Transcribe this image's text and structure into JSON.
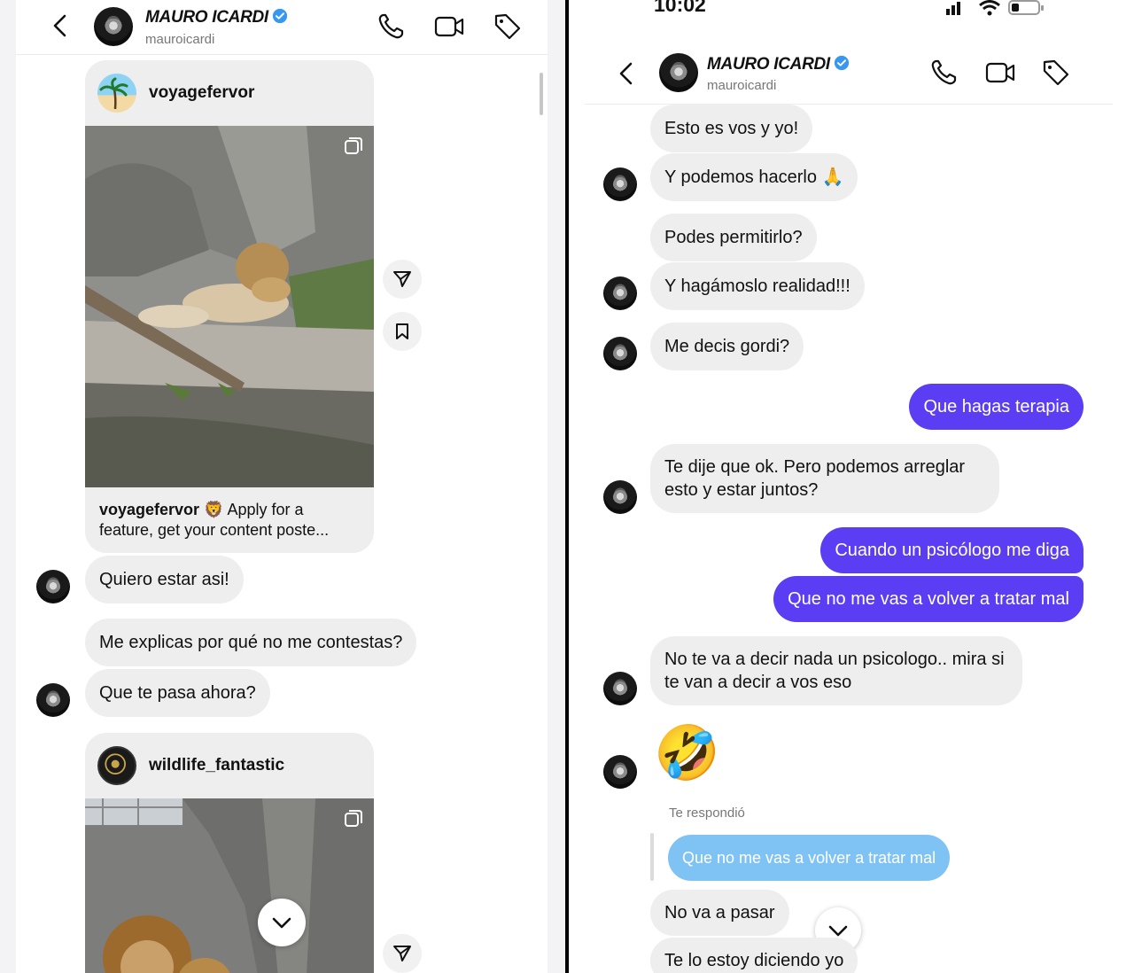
{
  "contact": {
    "name": "MAURO ICARDI",
    "username": "mauroicardi"
  },
  "left": {
    "post1": {
      "user": "voyagefervor",
      "caption_user": "voyagefervor",
      "caption_emoji": "🦁",
      "caption_text": "Apply for a feature, get your content poste..."
    },
    "messages": [
      "Quiero estar asi!",
      "Me explicas por qué no me contestas?",
      "Que te pasa ahora?"
    ],
    "post2": {
      "user": "wildlife_fantastic"
    }
  },
  "right": {
    "status": {
      "time": "10:02"
    },
    "messages": [
      "Esto es vos y yo!",
      "Y podemos hacerlo 🙏",
      "Podes permitirlo?",
      "Y hagámoslo realidad!!!",
      "Me decis gordi?",
      "Que hagas terapia",
      "Te dije que ok. Pero podemos arreglar esto y estar juntos?",
      "Cuando un psicólogo me diga",
      "Que no me vas a volver a tratar mal",
      "No te va a decir nada un psicologo.. mira si te van a decir a vos eso",
      "🤣",
      "No va a pasar",
      "Te lo estoy diciendo yo"
    ],
    "reply": {
      "label": "Te respondió",
      "quoted": "Que no me vas a volver a tratar mal"
    }
  },
  "colors": {
    "outgoing_bubble": "#5b3df4",
    "incoming_bubble": "#eeeeef",
    "verified": "#3897f0",
    "reply_quote": "#7fc3f5"
  },
  "icons": [
    "back-icon",
    "verified-icon",
    "phone-icon",
    "video-icon",
    "tag-icon",
    "share-icon",
    "save-icon",
    "multi-photo-icon",
    "chevron-down-icon",
    "signal-icon",
    "wifi-icon",
    "battery-icon"
  ]
}
